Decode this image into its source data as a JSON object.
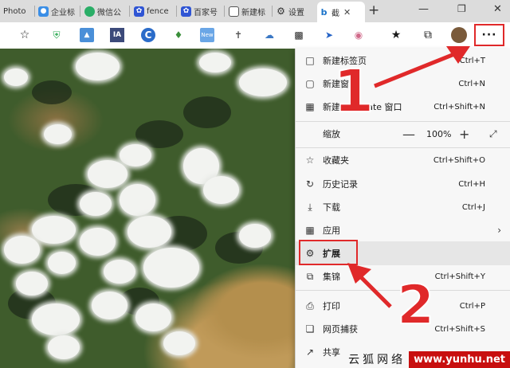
{
  "tabs": [
    {
      "label": "Photo",
      "icon": "photo-tab-favicon"
    },
    {
      "label": "企业标",
      "icon": "drop-favicon"
    },
    {
      "label": "微信公",
      "icon": "wechat-favicon"
    },
    {
      "label": "fence",
      "icon": "baidu-paw-favicon"
    },
    {
      "label": "百家号",
      "icon": "baidu-paw-favicon"
    },
    {
      "label": "新建标",
      "icon": "page-favicon"
    },
    {
      "label": "设置",
      "icon": "gear-favicon"
    },
    {
      "label": "截",
      "icon": "bing-favicon"
    }
  ],
  "menu": {
    "new_tab": {
      "label": "新建标签页",
      "shortcut": "Ctrl+T"
    },
    "new_window": {
      "label": "新建窗口",
      "shortcut": "Ctrl+N"
    },
    "new_private": {
      "label": "新建 InPrivate 窗口",
      "shortcut": "Ctrl+Shift+N"
    },
    "zoom": {
      "label": "缩放",
      "minus": "—",
      "value": "100%",
      "plus": "+"
    },
    "favorites": {
      "label": "收藏夹",
      "shortcut": "Ctrl+Shift+O"
    },
    "history": {
      "label": "历史记录",
      "shortcut": "Ctrl+H"
    },
    "downloads": {
      "label": "下载",
      "shortcut": "Ctrl+J"
    },
    "apps": {
      "label": "应用"
    },
    "extensions": {
      "label": "扩展"
    },
    "collections": {
      "label": "集锦",
      "shortcut": "Ctrl+Shift+Y"
    },
    "print": {
      "label": "打印",
      "shortcut": "Ctrl+P"
    },
    "web_capture": {
      "label": "网页捕获",
      "shortcut": "Ctrl+Shift+S"
    },
    "share": {
      "label": "共享"
    }
  },
  "toolbar": {
    "more_label": "···"
  },
  "annotations": {
    "step1": "1",
    "step2": "2",
    "color": "#e0292a"
  },
  "watermark": {
    "text": "云狐网络",
    "url": "www.yunhu.net"
  }
}
